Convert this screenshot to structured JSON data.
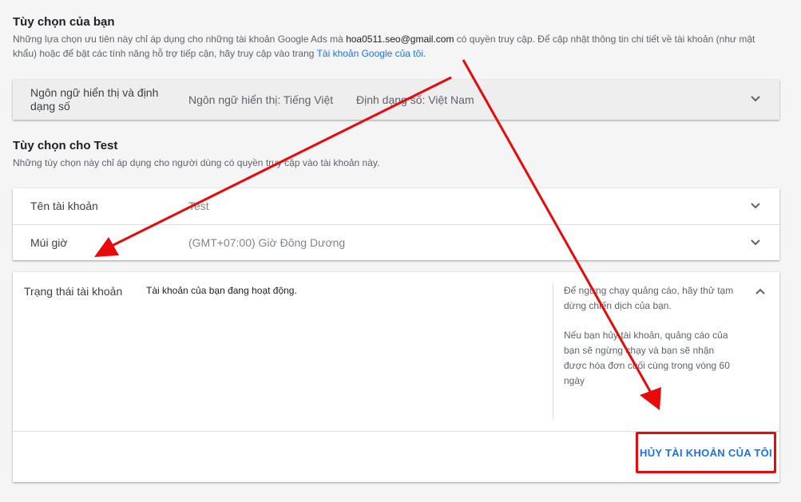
{
  "your_options": {
    "title": "Tùy chọn của bạn",
    "desc_part1": "Những lựa chọn ưu tiên này chỉ áp dụng cho những tài khoản Google Ads mà ",
    "email": "hoa0511.seo@gmail.com",
    "desc_part2": " có quyền truy cập. Để cập nhật thông tin chi tiết về tài khoản (như mật khẩu) hoặc để bật các tính năng hỗ trợ tiếp cận, hãy truy cập vào trang ",
    "link": "Tài khoản Google của tôi",
    "desc_end": ".",
    "language_row": {
      "label": "Ngôn ngữ hiển thị và định dạng số",
      "display_language": "Ngôn ngữ hiển thị: Tiếng Việt",
      "number_format": "Định dạng số: Việt Nam"
    }
  },
  "account_options": {
    "title": "Tùy chọn cho Test",
    "desc": "Những tùy chọn này chỉ áp dụng cho người dùng có quyền truy cập vào tài khoản này.",
    "rows": [
      {
        "label": "Tên tài khoản",
        "value": "Test"
      },
      {
        "label": "Múi giờ",
        "value": "(GMT+07:00) Giờ Đông Dương"
      }
    ]
  },
  "account_status": {
    "label": "Trạng thái tài khoản",
    "value": "Tài khoản của bạn đang hoạt động.",
    "help_1": "Để ngừng chạy quảng cáo, hãy thử tạm dừng chiến dịch của bạn.",
    "help_2": "Nếu bạn hủy tài khoản, quảng cáo của bạn sẽ ngừng chạy và bạn sẽ nhận được hóa đơn cuối cùng trong vòng 60 ngày",
    "cancel_button": "HỦY TÀI KHOẢN CỦA TÔI"
  },
  "colors": {
    "accent": "#1a73e8",
    "annotation": "#e8090b",
    "background": "#f5f5f5"
  },
  "icons": {
    "expand": "chevron-down-icon",
    "collapse": "chevron-up-icon"
  }
}
